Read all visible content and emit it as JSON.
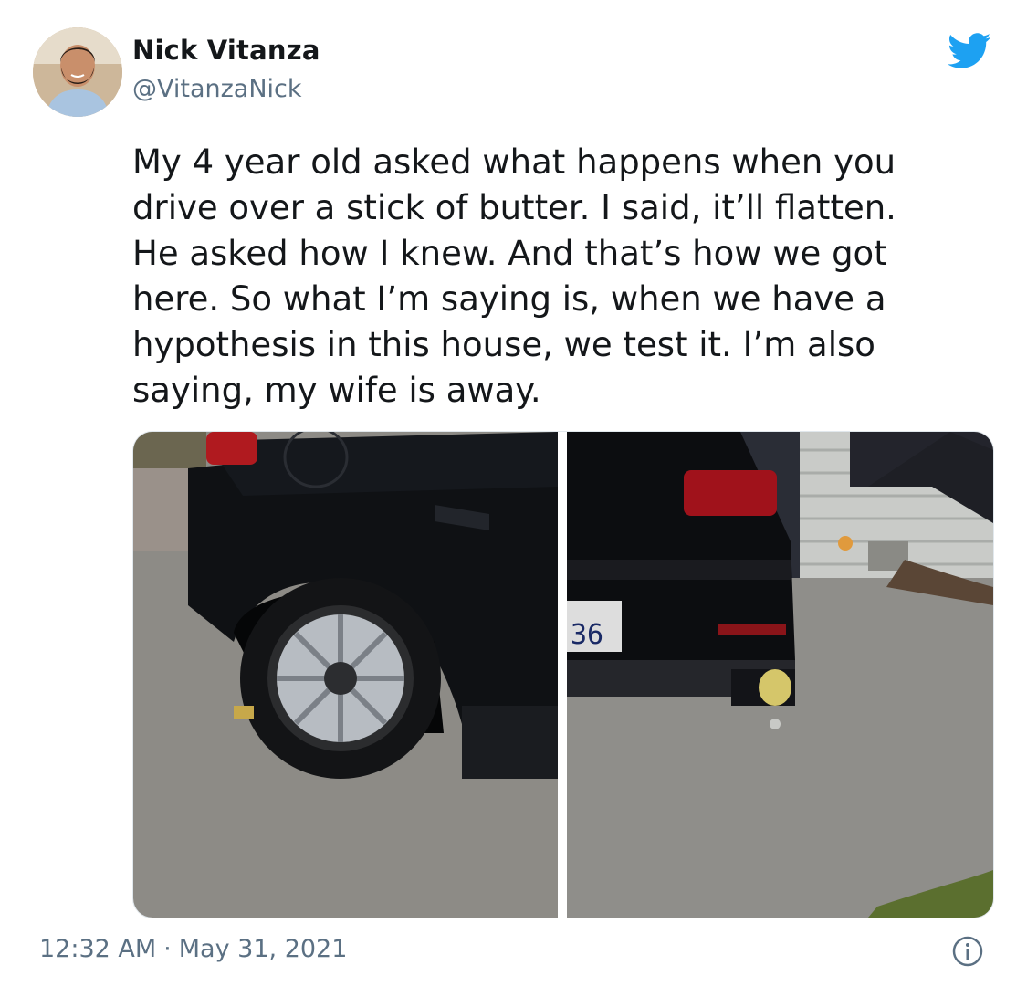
{
  "author": {
    "display_name": "Nick Vitanza",
    "handle": "@VitanzaNick",
    "avatar_icon": "avatar-photo"
  },
  "tweet": {
    "lines": [
      "My 4 year old asked what happens when you",
      "drive over a stick of butter. I said, it’ll flatten.",
      "He asked how I knew. And that’s how we got",
      "here. So what I’m saying is, when we have a",
      "hypothesis in this house, we test it. I’m also",
      "saying, my wife is away."
    ]
  },
  "media": {
    "photos": [
      {
        "description_icon": "car-side-photo"
      },
      {
        "description_icon": "car-rear-photo"
      }
    ],
    "plate_text": "36"
  },
  "footer": {
    "time": "12:32 AM",
    "separator": "·",
    "date": "May 31, 2021",
    "info_icon": "info-icon"
  },
  "colors": {
    "twitter_blue": "#1da1f2",
    "text": "#14171a",
    "muted": "#5b7083"
  }
}
